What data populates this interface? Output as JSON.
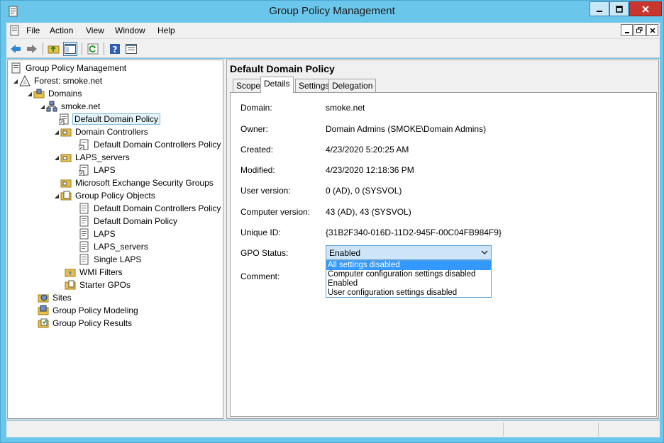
{
  "window": {
    "title": "Group Policy Management"
  },
  "menu": {
    "items": [
      "File",
      "Action",
      "View",
      "Window",
      "Help"
    ]
  },
  "toolbar": {
    "buttons": [
      "back-arrow-icon",
      "forward-arrow-icon",
      "up-folder-icon",
      "show-hide-tree-icon",
      "refresh-icon",
      "help-icon",
      "properties-icon"
    ]
  },
  "tree": {
    "root": "Group Policy Management",
    "forest": "Forest: smoke.net",
    "domains": "Domains",
    "domain": "smoke.net",
    "ddp": "Default Domain Policy",
    "dc": "Domain Controllers",
    "ddcp": "Default Domain Controllers Policy",
    "laps_servers": "LAPS_servers",
    "laps": "LAPS",
    "mesg": "Microsoft Exchange Security Groups",
    "gpo_objects": "Group Policy Objects",
    "gpo_ddcp": "Default Domain Controllers Policy",
    "gpo_ddp": "Default Domain Policy",
    "gpo_laps": "LAPS",
    "gpo_laps_servers": "LAPS_servers",
    "gpo_single_laps": "Single LAPS",
    "wmi": "WMI Filters",
    "starter": "Starter GPOs",
    "sites": "Sites",
    "modeling": "Group Policy Modeling",
    "results": "Group Policy Results"
  },
  "details": {
    "title": "Default Domain Policy",
    "tabs": [
      "Scope",
      "Details",
      "Settings",
      "Delegation"
    ],
    "labels": {
      "domain": "Domain:",
      "owner": "Owner:",
      "created": "Created:",
      "modified": "Modified:",
      "user_version": "User version:",
      "computer_version": "Computer version:",
      "unique_id": "Unique ID:",
      "gpo_status": "GPO Status:",
      "comment": "Comment:"
    },
    "values": {
      "domain": "smoke.net",
      "owner": "Domain Admins (SMOKE\\Domain Admins)",
      "created": "4/23/2020 5:20:25 AM",
      "modified": "4/23/2020 12:18:36 PM",
      "user_version": "0 (AD), 0 (SYSVOL)",
      "computer_version": "43 (AD), 43 (SYSVOL)",
      "unique_id": "{31B2F340-016D-11D2-945F-00C04FB984F9}"
    },
    "gpo_status": {
      "selected": "Enabled",
      "options": [
        "All settings disabled",
        "Computer configuration settings disabled",
        "Enabled",
        "User configuration settings disabled"
      ]
    }
  }
}
